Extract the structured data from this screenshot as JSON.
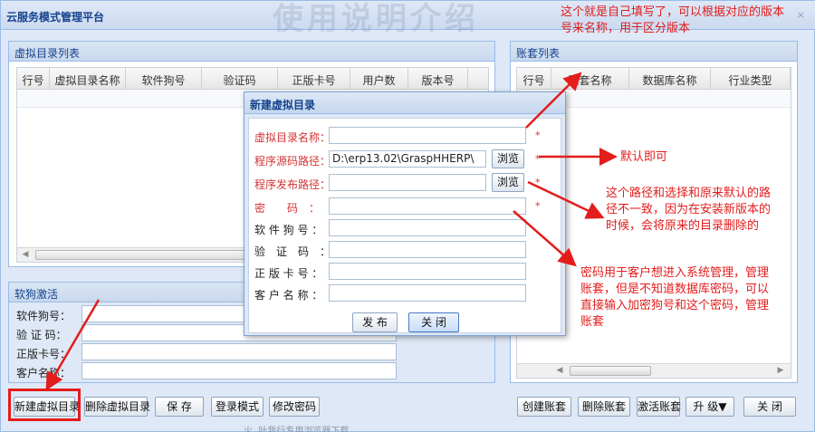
{
  "window": {
    "title": "云服务模式管理平台",
    "watermark": "使用说明介绍",
    "close_glyph": "×"
  },
  "virtual_dir_panel": {
    "title": "虚拟目录列表",
    "columns": [
      "行号",
      "虚拟目录名称",
      "软件狗号",
      "验证码",
      "正版卡号",
      "用户数",
      "版本号"
    ]
  },
  "account_panel": {
    "title": "账套列表",
    "columns": [
      "行号",
      "账套名称",
      "数据库名称",
      "行业类型"
    ]
  },
  "dongle_panel": {
    "title": "软狗激活",
    "fields": [
      {
        "label": "软件狗号：",
        "value": ""
      },
      {
        "label": "验 证 码：",
        "value": ""
      },
      {
        "label": "正版卡号：",
        "value": ""
      },
      {
        "label": "客户名称：",
        "value": ""
      }
    ]
  },
  "bottom_left_buttons": [
    "新建虚拟目录",
    "删除虚拟目录",
    "保 存",
    "登录模式",
    "修改密码"
  ],
  "bottom_right_buttons": [
    "创建账套",
    "删除账套",
    "激活账套",
    "升 级▼",
    "关 闭"
  ],
  "footer_text": "火, 叶我行专用浏览器下载",
  "dialog": {
    "title": "新建虚拟目录",
    "fields": [
      {
        "label": "虚拟目录名称：",
        "value": "",
        "required": true
      },
      {
        "label": "程序源码路径：",
        "value": "D:\\erp13.02\\GraspHHERP\\",
        "required": true
      },
      {
        "label": "程序发布路径：",
        "value": "",
        "required": true
      },
      {
        "label": "密　　码　：",
        "value": "",
        "required": true
      },
      {
        "label": "软 件 狗 号 ：",
        "value": "",
        "required": false
      },
      {
        "label": "验　证　码　：",
        "value": "",
        "required": false
      },
      {
        "label": "正 版 卡 号 ：",
        "value": "",
        "required": false
      },
      {
        "label": "客 户 名 称 ：",
        "value": "",
        "required": false
      }
    ],
    "browse_label": "浏览",
    "required_mark": "*",
    "publish_label": "发 布",
    "close_label": "关 闭"
  },
  "annotations": {
    "name_note": "这个就是自己填写了，可以根据对应的版本号来名称，用于区分版本",
    "source_note": "默认即可",
    "publish_note": "这个路径和选择和原来默认的路径不一致，因为在安装新版本的时候，会将原来的目录删除的",
    "password_note": "密码用于客户想进入系统管理，管理账套，但是不知道数据库密码，可以直接输入加密狗号和这个密码，管理账套"
  },
  "colors": {
    "accent": "#15428b",
    "annotation_red": "#e31c1c",
    "panel_border": "#99bbe8"
  }
}
